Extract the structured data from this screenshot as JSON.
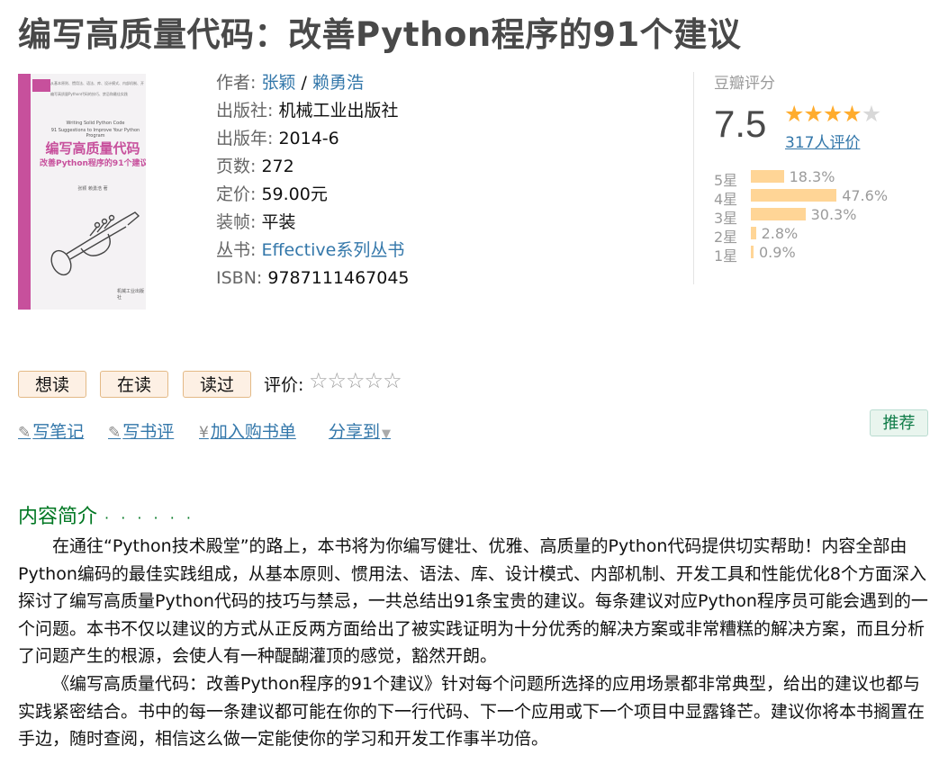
{
  "book": {
    "title": "编写高质量代码：改善Python程序的91个建议",
    "cover": {
      "tagline1": "从基本原则、惯用法、语法、库、设计模式、内部机制、开发工具和性能优化8个方面深入探讨",
      "tagline2": "编写高质量Python代码的技巧、禁忌和最佳实践",
      "english_title": "Writing Solid Python Code",
      "english_subtitle": "91 Suggestions to Improve Your Python Program",
      "cn_title": "编写高质量代码",
      "cn_subtitle": "改善Python程序的91个建议",
      "authors": "张颖 赖勇浩 著",
      "publisher": "机械工业出版社"
    },
    "info": {
      "author_label": "作者:",
      "author1": "张颖",
      "author_sep": " / ",
      "author2": "赖勇浩",
      "publisher_label": "出版社:",
      "publisher": "机械工业出版社",
      "year_label": "出版年:",
      "year": "2014-6",
      "pages_label": "页数:",
      "pages": "272",
      "price_label": "定价:",
      "price": "59.00元",
      "binding_label": "装帧:",
      "binding": "平装",
      "series_label": "丛书:",
      "series": "Effective系列丛书",
      "isbn_label": "ISBN:",
      "isbn": "9787111467045"
    }
  },
  "rating": {
    "title": "豆瓣评分",
    "score": "7.5",
    "stars_filled": 4,
    "stars_total": 5,
    "votes": "317人评价",
    "bars": [
      {
        "label": "5星",
        "percent": 18.3,
        "text": "18.3%"
      },
      {
        "label": "4星",
        "percent": 47.6,
        "text": "47.6%"
      },
      {
        "label": "3星",
        "percent": 30.3,
        "text": "30.3%"
      },
      {
        "label": "2星",
        "percent": 2.8,
        "text": "2.8%"
      },
      {
        "label": "1星",
        "percent": 0.9,
        "text": "0.9%"
      }
    ],
    "bar_color": "#ffd596"
  },
  "actions": {
    "want": "想读",
    "reading": "在读",
    "read": "读过",
    "rate_label": "评价:",
    "write_note": "写笔记",
    "write_review": "写书评",
    "add_cart": "加入购书单",
    "share": "分享到",
    "recommend": "推荐"
  },
  "intro": {
    "heading": "内容简介",
    "heading_dots": "· · · · · ·",
    "paragraphs": [
      "在通往“Python技术殿堂”的路上，本书将为你编写健壮、优雅、高质量的Python代码提供切实帮助！内容全部由Python编码的最佳实践组成，从基本原则、惯用法、语法、库、设计模式、内部机制、开发工具和性能优化8个方面深入探讨了编写高质量Python代码的技巧与禁忌，一共总结出91条宝贵的建议。每条建议对应Python程序员可能会遇到的一个问题。本书不仅以建议的方式从正反两方面给出了被实践证明为十分优秀的解决方案或非常糟糕的解决方案，而且分析了问题产生的根源，会使人有一种醍醐灌顶的感觉，豁然开朗。",
      "《编写高质量代码：改善Python程序的91个建议》针对每个问题所选择的应用场景都非常典型，给出的建议也都与实践紧密结合。书中的每一条建议都可能在你的下一行代码、下一个应用或下一个项目中显露锋芒。建议你将本书搁置在手边，随时查阅，相信这么做一定能使你的学习和开发工作事半功倍。"
    ]
  },
  "colors": {
    "link": "#3377aa",
    "star": "#ffac2d",
    "heading_green": "#007722",
    "cover_accent": "#c7509c"
  }
}
